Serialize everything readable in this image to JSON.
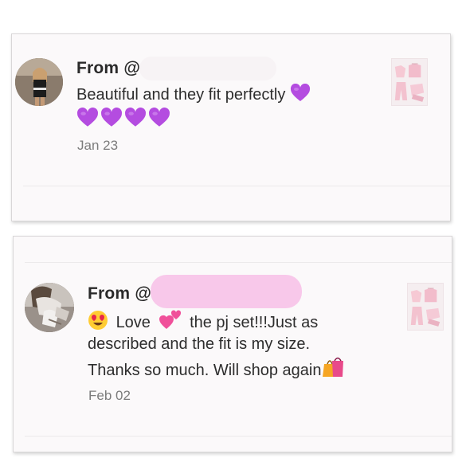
{
  "reviews": [
    {
      "from_label": "From @",
      "message": "Beautiful and they fit perfectly",
      "heart_count_line1": 1,
      "heart_count_line2": 4,
      "date": "Jan 23"
    },
    {
      "from_label": "From @",
      "message_part1": "Love",
      "message_part2": "the pj set!!!Just as",
      "message_line2": "described and the fit is my size.",
      "message_line3": "Thanks so much. Will shop again",
      "date": "Feb 02"
    }
  ],
  "icons": [
    "purple-heart-icon",
    "heart-eyes-emoji-icon",
    "two-hearts-icon",
    "shopping-bags-icon"
  ],
  "colors": {
    "card_bg": "#fbf9fa",
    "redaction_1": "#f7f3f5",
    "redaction_2": "#f8c8ea",
    "purple_heart": "#b44ce0"
  }
}
